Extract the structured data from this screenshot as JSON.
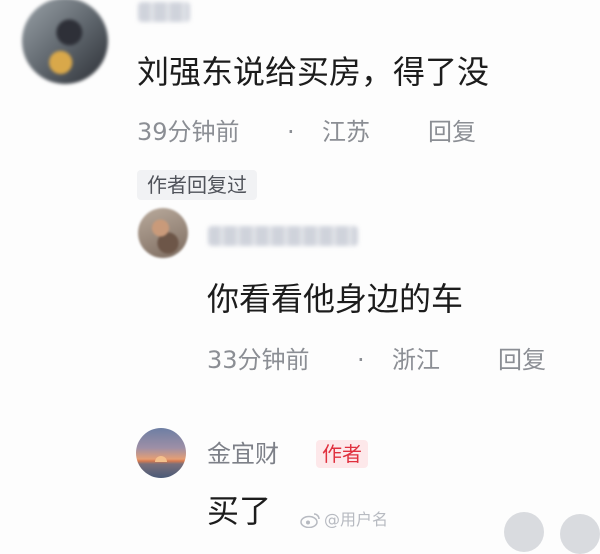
{
  "comment1": {
    "text": "刘强东说给买房，得了没",
    "time": "39分钟前",
    "sep": "·",
    "location": "江苏",
    "reply": "回复",
    "author_replied": "作者回复过"
  },
  "comment2": {
    "text": "你看看他身边的车",
    "time": "33分钟前",
    "sep": "·",
    "location": "浙江",
    "reply": "回复"
  },
  "comment3": {
    "username": "金宜财",
    "author_tag": "作者",
    "text": "买了"
  },
  "watermark": {
    "icon": "weibo-icon",
    "text": "@用户名"
  },
  "colors": {
    "author_tag_bg": "#fde8ea",
    "author_tag_text": "#e0303e",
    "meta_text": "#8b8e94"
  }
}
